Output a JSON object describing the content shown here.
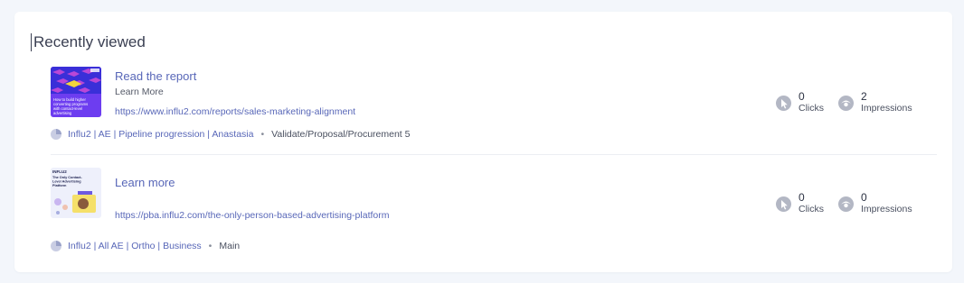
{
  "heading": "Recently viewed",
  "items": [
    {
      "title": "Read the report",
      "subtitle": "Learn More",
      "url": "https://www.influ2.com/reports/sales-marketing-alignment",
      "campaign": "Influ2 | AE | Pipeline progression | Anastasia",
      "stage": "Validate/Proposal/Procurement 5",
      "clicks": "0",
      "clicks_label": "Clicks",
      "impressions": "2",
      "impressions_label": "Impressions"
    },
    {
      "title": "Learn more",
      "subtitle": "",
      "url": "https://pba.influ2.com/the-only-person-based-advertising-platform",
      "campaign": "Influ2 | All AE | Ortho | Business",
      "stage": "Main",
      "clicks": "0",
      "clicks_label": "Clicks",
      "impressions": "0",
      "impressions_label": "Impressions"
    }
  ],
  "thumb1_text": "How to build higher converting programs with contact-level advertising",
  "thumb2_brand": "INFLU2",
  "thumb2_text": "The Only Contact-Level Advertising Platform",
  "colors": {
    "link": "#5867b8",
    "icon": "#b3b7c4",
    "background": "#f3f6fb"
  },
  "icons": {
    "clicks": "cursor-icon",
    "impressions": "eye-icon",
    "campaign": "pie-chart-icon"
  }
}
